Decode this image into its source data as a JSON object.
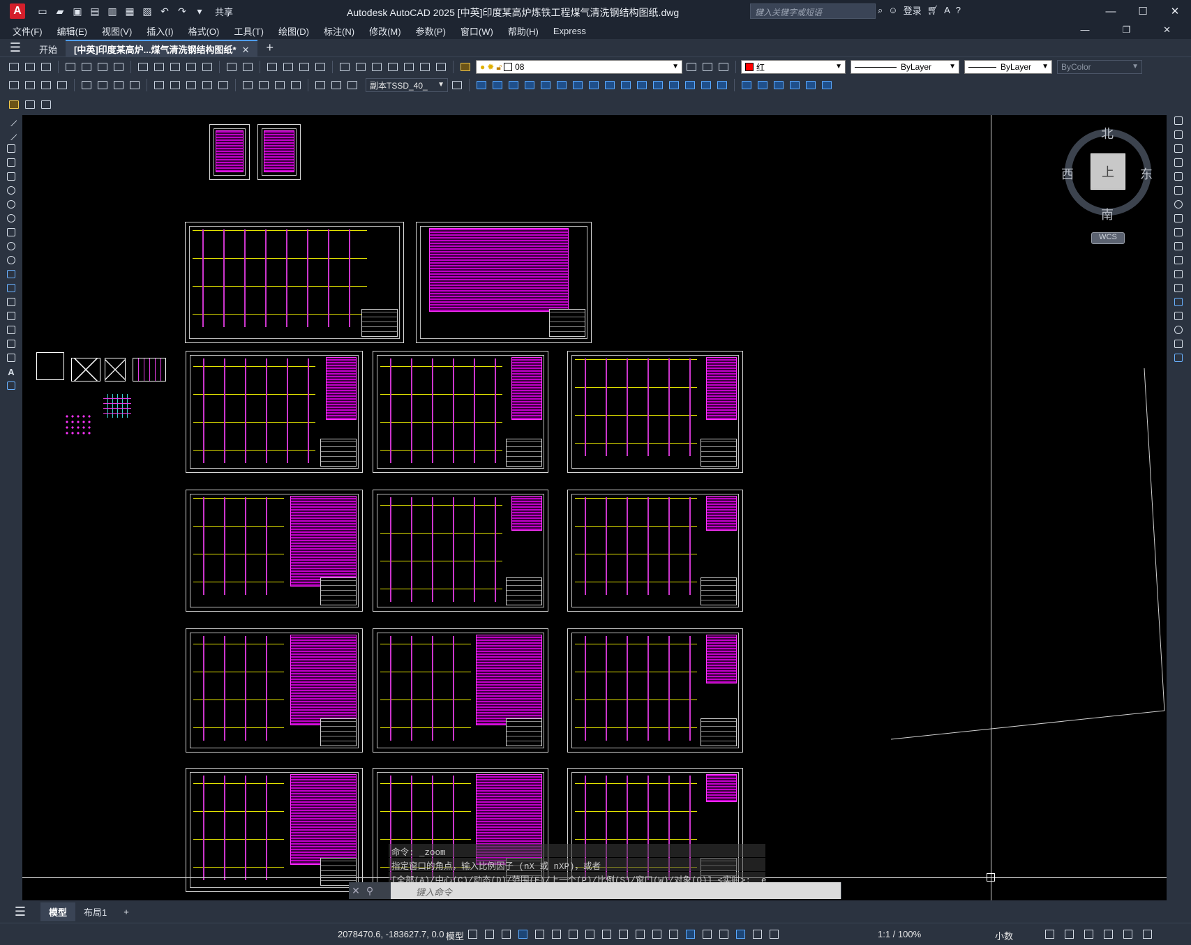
{
  "app": {
    "logo": "A",
    "title": "Autodesk AutoCAD 2025    [中英]印度某高炉炼铁工程煤气清洗钢结构图纸.dwg",
    "share": "共享",
    "search_placeholder": "键入关键字或短语",
    "login": "登录"
  },
  "menu": [
    "文件(F)",
    "编辑(E)",
    "视图(V)",
    "插入(I)",
    "格式(O)",
    "工具(T)",
    "绘图(D)",
    "标注(N)",
    "修改(M)",
    "参数(P)",
    "窗口(W)",
    "帮助(H)",
    "Express"
  ],
  "tabs": {
    "start": "开始",
    "active_doc": "[中英]印度某高炉...煤气清洗钢结构图纸*"
  },
  "properties": {
    "layer": "08",
    "color_name": "红",
    "linetype": "ByLayer",
    "lineweight": "ByLayer",
    "plotstyle": "ByColor",
    "textstyle": "副本TSSD_40_"
  },
  "viewcube": {
    "north": "北",
    "south": "南",
    "east": "东",
    "west": "西",
    "face": "上",
    "ucs": "WCS"
  },
  "command": {
    "history": [
      "命令: _zoom",
      "指定窗口的角点，输入比例因子 (nX 或 nXP)，或者",
      "[全部(A)/中心(C)/动态(D)/范围(E)/上一个(P)/比例(S)/窗口(W)/对象(O)] <实时>: _e"
    ],
    "placeholder": "键入命令"
  },
  "layouts": {
    "model": "模型",
    "layout1": "布局1"
  },
  "status": {
    "coords": "2078470.6, -183627.7, 0.0",
    "space": "模型",
    "scale": "1:1 / 100%",
    "units": "小数"
  },
  "colors": {
    "drawing_magenta": "#e33be3",
    "drawing_yellow": "#ffff00",
    "ui_dark": "#2b3340",
    "accent_red": "#ff0000"
  }
}
